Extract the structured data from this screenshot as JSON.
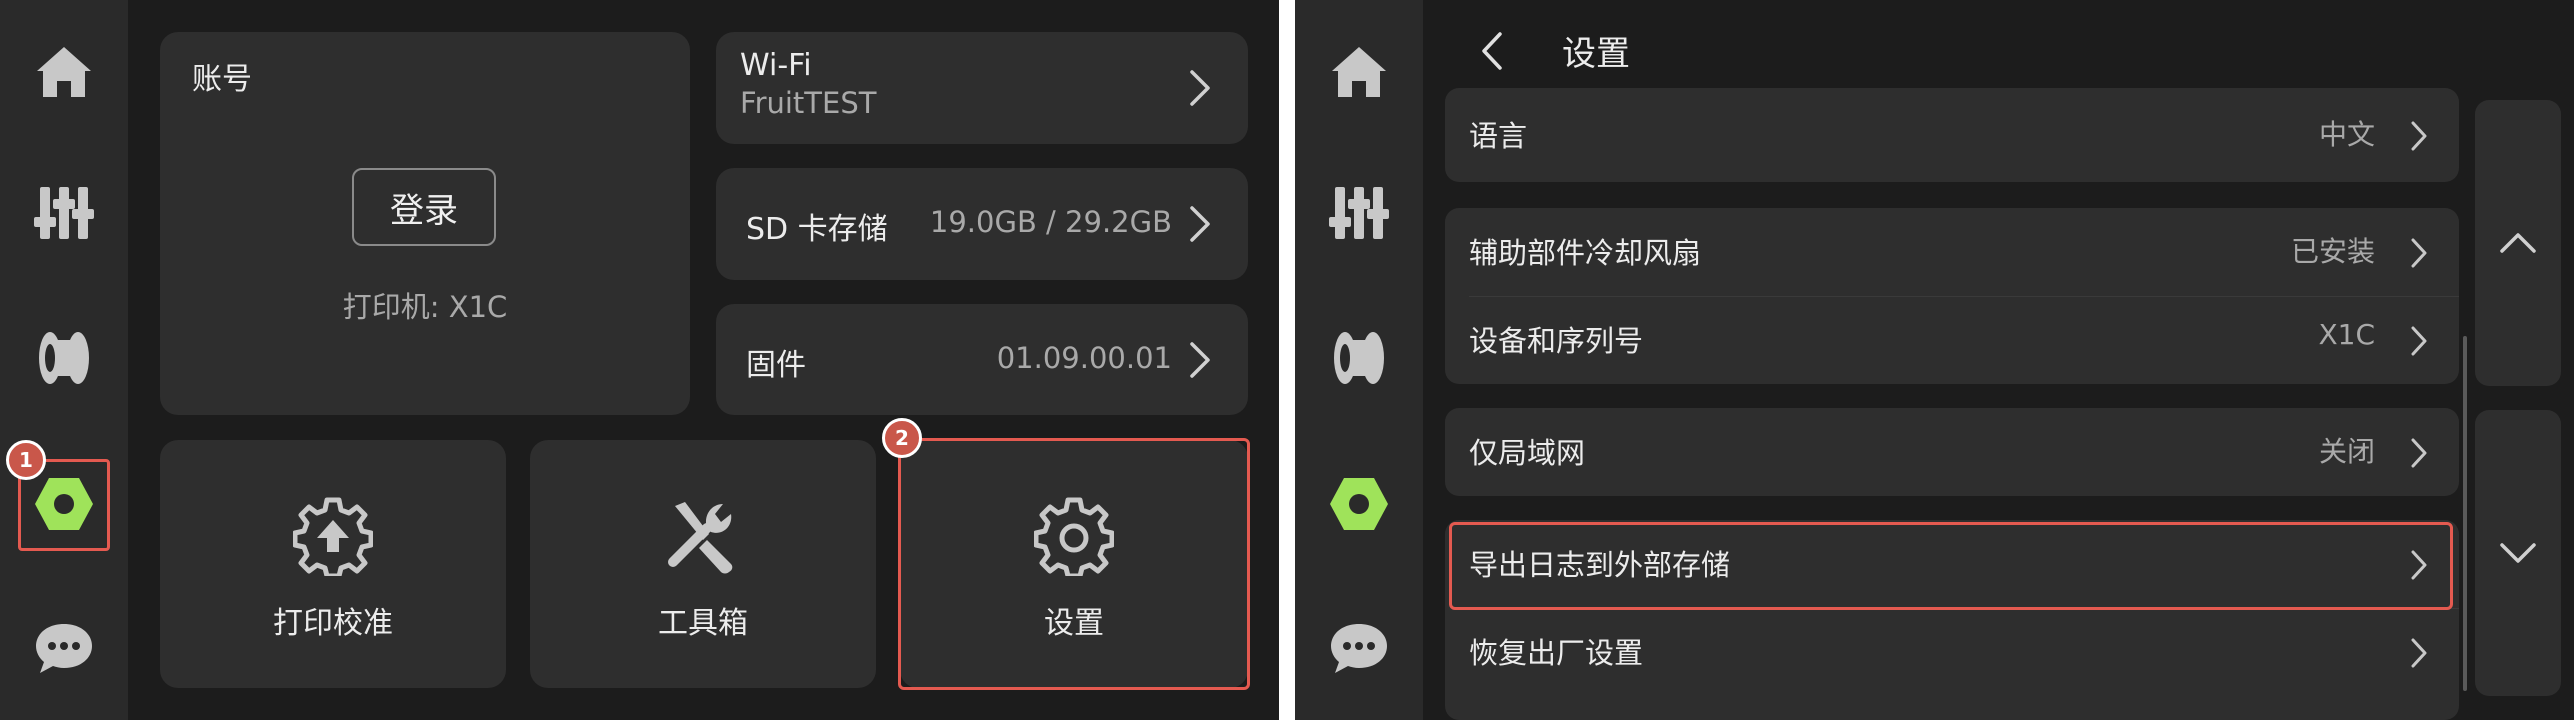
{
  "colors": {
    "accent": "#9fe35a",
    "highlight": "#e45a50",
    "badge": "#c9574a"
  },
  "left": {
    "sidebar": {
      "items": [
        {
          "icon": "home-icon"
        },
        {
          "icon": "sliders-icon"
        },
        {
          "icon": "filament-spool-icon"
        },
        {
          "icon": "settings-hex-icon",
          "selected": true
        },
        {
          "icon": "chat-icon"
        }
      ],
      "badge": "1"
    },
    "account": {
      "title": "账号",
      "login_label": "登录",
      "printer_label": "打印机: X1C"
    },
    "wifi": {
      "label": "Wi-Fi",
      "value": "FruitTEST"
    },
    "sd_card": {
      "label": "SD 卡存储",
      "value": "19.0GB / 29.2GB"
    },
    "firmware": {
      "label": "固件",
      "value": "01.09.00.01"
    },
    "tiles": [
      {
        "label": "打印校准",
        "icon": "gear-upload-icon"
      },
      {
        "label": "工具箱",
        "icon": "tools-icon"
      },
      {
        "label": "设置",
        "icon": "gear-icon"
      }
    ],
    "tile_badge": "2"
  },
  "right": {
    "header": {
      "title": "设置"
    },
    "rows": [
      {
        "label": "语言",
        "value": "中文"
      },
      {
        "label": "辅助部件冷却风扇",
        "value": "已安装"
      },
      {
        "label": "设备和序列号",
        "value": "X1C"
      },
      {
        "label": "仅局域网",
        "value": "关闭"
      },
      {
        "label": "导出日志到外部存储",
        "value": ""
      },
      {
        "label": "恢复出厂设置",
        "value": ""
      }
    ]
  }
}
